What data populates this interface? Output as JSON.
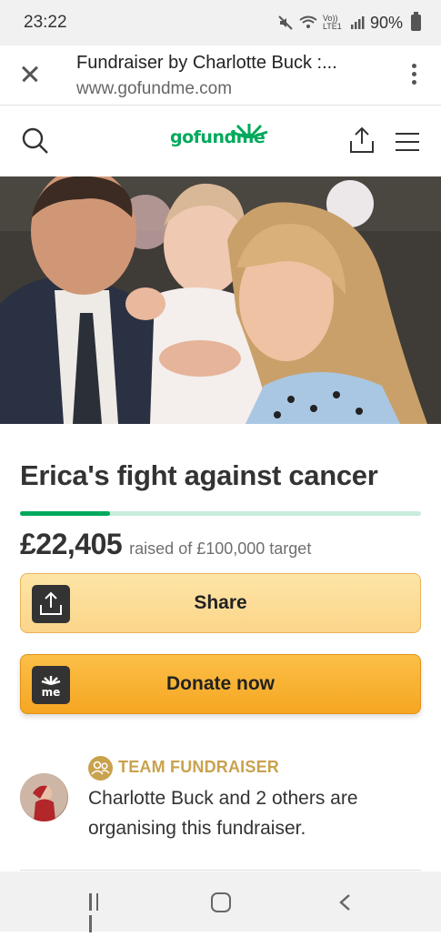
{
  "status_bar": {
    "time": "23:22",
    "icons": [
      "mute-icon",
      "wifi-icon",
      "volte-icon",
      "signal-icon"
    ],
    "volte_label": "Vo)) LTE1",
    "battery": "90%"
  },
  "browser": {
    "title": "Fundraiser by Charlotte Buck :...",
    "url": "www.gofundme.com"
  },
  "site_header": {
    "logo_text": "gofundme"
  },
  "campaign": {
    "title": "Erica's fight against cancer",
    "raised": "£22,405",
    "raised_suffix": "raised of £100,000 target",
    "progress_fraction": 0.224
  },
  "actions": {
    "share_label": "Share",
    "donate_label": "Donate now",
    "donate_icon_text": "me"
  },
  "organiser": {
    "badge": "TEAM FUNDRAISER",
    "text": "Charlotte Buck and 2 others are organising this fundraiser."
  },
  "colors": {
    "brand_green": "#02a95c",
    "progress_track": "#c8eddb",
    "share_button": "#fbd58a",
    "donate_button": "#f6a622",
    "team_gold": "#c9a24e"
  }
}
